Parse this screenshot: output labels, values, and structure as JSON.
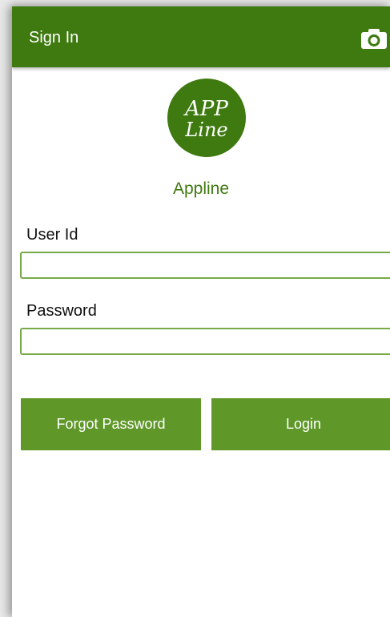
{
  "appbar": {
    "title": "Sign In",
    "camera_icon": "camera-icon",
    "background_color": "#3f7a10"
  },
  "logo": {
    "line1": "APP",
    "line2": "Line",
    "background_color": "#3f7a10"
  },
  "app_name": "Appline",
  "form": {
    "user_id": {
      "label": "User Id",
      "value": "",
      "placeholder": ""
    },
    "password": {
      "label": "Password",
      "value": "",
      "placeholder": ""
    }
  },
  "buttons": {
    "forgot_password": "Forgot Password",
    "login": "Login",
    "color": "#5f9828"
  },
  "colors": {
    "input_border": "#78a948"
  }
}
